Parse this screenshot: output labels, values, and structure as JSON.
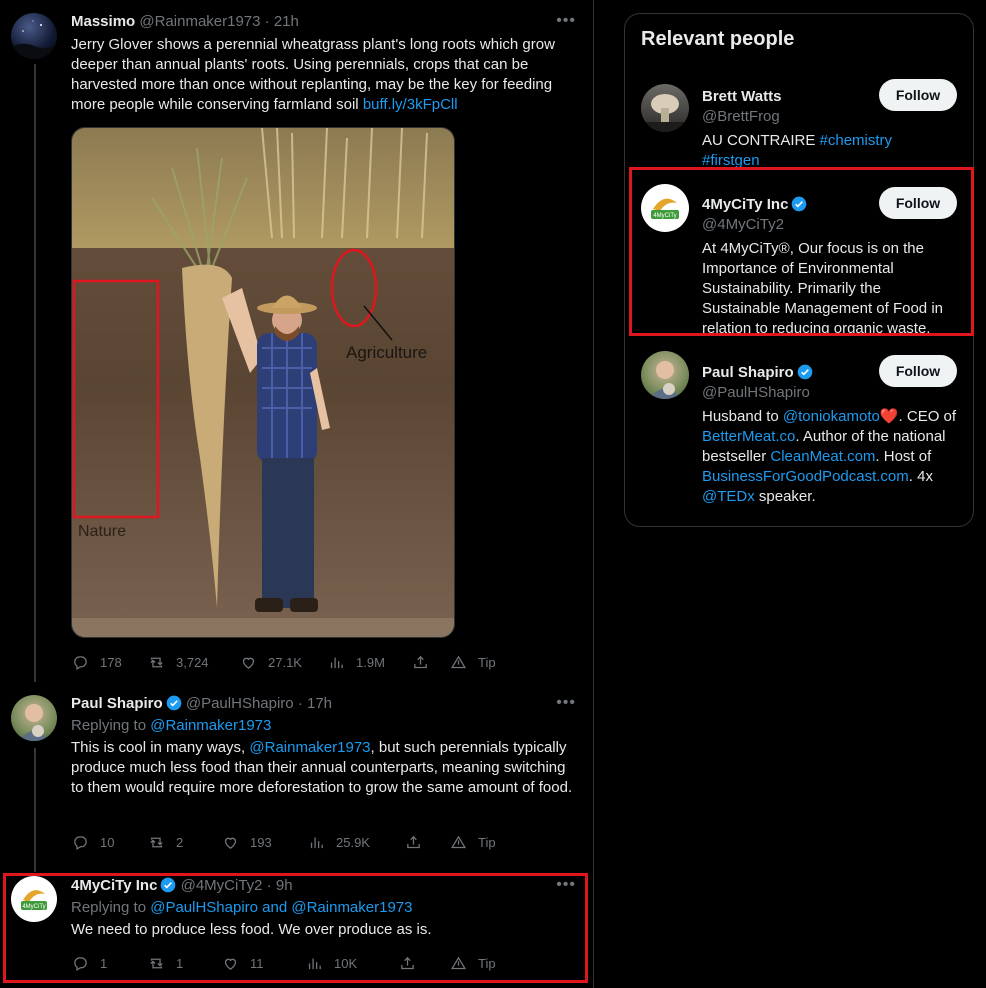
{
  "tweets": [
    {
      "name": "Massimo",
      "handle": "@Rainmaker1973",
      "time": "21h",
      "text": "Jerry Glover shows a perennial wheatgrass plant's long roots which grow deeper than annual plants' roots. Using perennials, crops that can be harvested more than once without replanting, may be the key for feeding more people while conserving farmland soil ",
      "link": "buff.ly/3kFpCll",
      "image_labels": {
        "agriculture": "Agriculture",
        "nature": "Nature"
      },
      "stats": {
        "replies": "178",
        "retweets": "3,724",
        "likes": "27.1K",
        "views": "1.9M",
        "tip": "Tip"
      }
    },
    {
      "name": "Paul Shapiro",
      "handle": "@PaulHShapiro",
      "time": "17h",
      "replying_prefix": "Replying to ",
      "replying_to": "@Rainmaker1973",
      "text_a": "This is cool in many ways, ",
      "mention": "@Rainmaker1973",
      "text_b": ", but such perennials typically produce much less food than their annual counterparts, meaning switching to them would require more deforestation to grow the same amount of food.",
      "stats": {
        "replies": "10",
        "retweets": "2",
        "likes": "193",
        "views": "25.9K",
        "tip": "Tip"
      }
    },
    {
      "name": "4MyCiTy Inc",
      "handle": "@4MyCiTy2",
      "time": "9h",
      "replying_prefix": "Replying to ",
      "replying_to": "@PaulHShapiro and @Rainmaker1973",
      "text": "We need to produce less food. We over produce as is.",
      "stats": {
        "replies": "1",
        "retweets": "1",
        "likes": "11",
        "views": "10K",
        "tip": "Tip"
      }
    }
  ],
  "sidebar": {
    "title": "Relevant people",
    "follow_label": "Follow",
    "people": [
      {
        "name": "Brett Watts",
        "handle": "@BrettFrog",
        "bio_a": "AU CONTRAIRE ",
        "tag1": "#chemistry",
        "tag2": "#firstgen"
      },
      {
        "name": "4MyCiTy Inc",
        "handle": "@4MyCiTy2",
        "bio": "At 4MyCiTy®, Our focus is on the Importance of Environmental Sustainability. Primarily the Sustainable Management of Food in relation to reducing organic waste."
      },
      {
        "name": "Paul Shapiro",
        "handle": "@PaulHShapiro",
        "bio_1": "Husband to ",
        "mention1": "@toniokamoto",
        "heart": "❤️",
        "bio_2": ". CEO of ",
        "link1": "BetterMeat.co",
        "bio_3": ". Author of the national bestseller ",
        "link2": "CleanMeat.com",
        "bio_4": ". Host of ",
        "link3": "BusinessForGoodPodcast.com",
        "bio_5": ". 4x ",
        "mention2": "@TEDx",
        "bio_6": " speaker."
      }
    ]
  },
  "colors": {
    "accent": "#1d9bf0",
    "highlight_box": "#e0161e",
    "verified": "#1d9bf0"
  },
  "icons": [
    "reply-icon",
    "retweet-icon",
    "like-icon",
    "views-icon",
    "share-icon",
    "tip-icon",
    "more-icon",
    "verified-badge-icon"
  ]
}
